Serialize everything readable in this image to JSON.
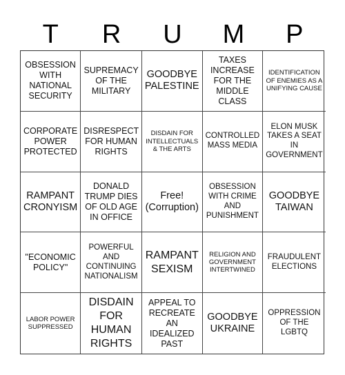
{
  "title_letters": [
    "T",
    "R",
    "U",
    "M",
    "P"
  ],
  "cells": [
    {
      "text": "OBSESSION WITH NATIONAL SECURITY",
      "size": "s12"
    },
    {
      "text": "SUPREMACY OF THE MILITARY",
      "size": "s12"
    },
    {
      "text": "GOODBYE PALESTINE",
      "size": "s14"
    },
    {
      "text": "TAXES INCREASE FOR THE MIDDLE CLASS",
      "size": "s12"
    },
    {
      "text": "IDENTIFICATION OF ENEMIES AS A UNIFYING CAUSE",
      "size": "s9"
    },
    {
      "text": "CORPORATE POWER PROTECTED",
      "size": "s12"
    },
    {
      "text": "DISRESPECT FOR HUMAN RIGHTS",
      "size": "s12"
    },
    {
      "text": "DISDAIN FOR INTELLECTUALS & THE ARTS",
      "size": "s9"
    },
    {
      "text": "CONTROLLED MASS MEDIA",
      "size": "s11"
    },
    {
      "text": "ELON MUSK TAKES A SEAT IN GOVERNMENT",
      "size": "s11"
    },
    {
      "text": "RAMPANT CRONYISM",
      "size": "s14"
    },
    {
      "text": "DONALD TRUMP DIES OF OLD AGE IN OFFICE",
      "size": "s12"
    },
    {
      "text": "Free! (Corruption)",
      "size": "s14"
    },
    {
      "text": "OBSESSION WITH CRIME AND PUNISHMENT",
      "size": "s11"
    },
    {
      "text": "GOODBYE TAIWAN",
      "size": "s14"
    },
    {
      "text": "\"ECONOMIC POLICY\"",
      "size": "s12"
    },
    {
      "text": "POWERFUL AND CONTINUING NATIONALISM",
      "size": "s11"
    },
    {
      "text": "RAMPANT SEXISM",
      "size": "s15"
    },
    {
      "text": "RELIGION AND GOVERNMENT INTERTWINED",
      "size": "s9"
    },
    {
      "text": "FRAUDULENT ELECTIONS",
      "size": "s11"
    },
    {
      "text": "LABOR POWER SUPPRESSED",
      "size": "s9"
    },
    {
      "text": "DISDAIN FOR HUMAN RIGHTS",
      "size": "s15"
    },
    {
      "text": "APPEAL TO RECREATE AN IDEALIZED PAST",
      "size": "s12"
    },
    {
      "text": "GOODBYE UKRAINE",
      "size": "s14"
    },
    {
      "text": "OPPRESSION OF THE LGBTQ",
      "size": "s11"
    }
  ]
}
